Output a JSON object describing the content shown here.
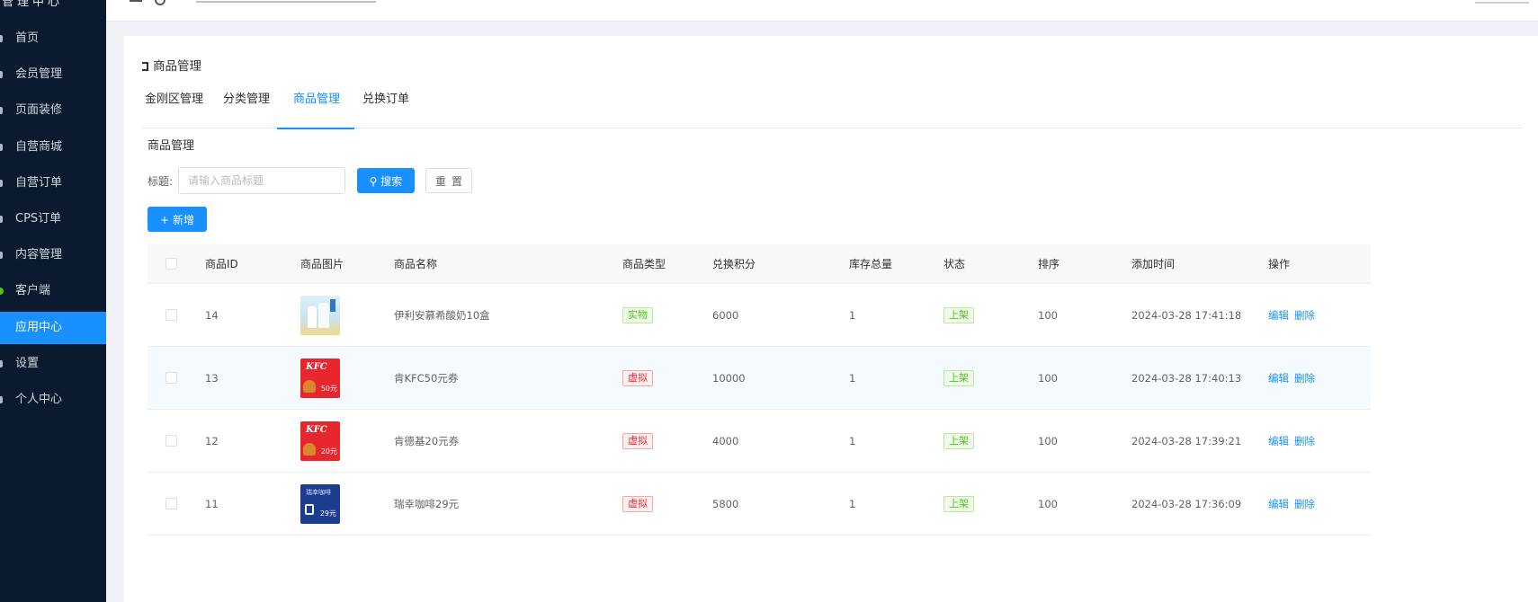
{
  "sidebar": {
    "brand": "管理中心",
    "items": [
      {
        "label": "首页"
      },
      {
        "label": "会员管理"
      },
      {
        "label": "页面装修"
      },
      {
        "label": "自营商城"
      },
      {
        "label": "自营订单"
      },
      {
        "label": "CPS订单"
      },
      {
        "label": "内容管理"
      },
      {
        "label": "客户端"
      },
      {
        "label": "应用中心",
        "active": true
      },
      {
        "label": "设置"
      },
      {
        "label": "个人中心"
      }
    ]
  },
  "page": {
    "title": "商品管理",
    "tabs": [
      {
        "label": "金刚区管理"
      },
      {
        "label": "分类管理"
      },
      {
        "label": "商品管理",
        "active": true
      },
      {
        "label": "兑换订单"
      }
    ],
    "section_title": "商品管理"
  },
  "filter": {
    "label": "标题:",
    "placeholder": "请输入商品标题",
    "search_label": "搜索",
    "reset_label": "重置",
    "add_label": "新增"
  },
  "table": {
    "headers": [
      "商品ID",
      "商品图片",
      "商品名称",
      "商品类型",
      "兑换积分",
      "库存总量",
      "状态",
      "排序",
      "添加时间",
      "操作"
    ],
    "rows": [
      {
        "id": "14",
        "image": "yili",
        "name": "伊利安慕希酸奶10盒",
        "type": "实物",
        "type_color": "green",
        "points": "6000",
        "stock": "1",
        "status": "上架",
        "sort": "100",
        "time": "2024-03-28 17:41:18",
        "edit": "编辑",
        "delete": "删除"
      },
      {
        "id": "13",
        "image": "kfc",
        "image_value": "50元",
        "name": "肯KFC50元券",
        "type": "虚拟",
        "type_color": "red",
        "points": "10000",
        "stock": "1",
        "status": "上架",
        "sort": "100",
        "time": "2024-03-28 17:40:13",
        "edit": "编辑",
        "delete": "删除"
      },
      {
        "id": "12",
        "image": "kfc",
        "image_value": "20元",
        "name": "肯德基20元券",
        "type": "虚拟",
        "type_color": "red",
        "points": "4000",
        "stock": "1",
        "status": "上架",
        "sort": "100",
        "time": "2024-03-28 17:39:21",
        "edit": "编辑",
        "delete": "删除"
      },
      {
        "id": "11",
        "image": "luckin",
        "image_top": "瑞幸咖啡",
        "image_value": "29元",
        "name": "瑞幸咖啡29元",
        "type": "虚拟",
        "type_color": "red",
        "points": "5800",
        "stock": "1",
        "status": "上架",
        "sort": "100",
        "time": "2024-03-28 17:36:09",
        "edit": "编辑",
        "delete": "删除"
      }
    ]
  },
  "colors": {
    "sidebar_bg": "#0b1a2e",
    "primary": "#1890ff",
    "tag_green": "#52c41a",
    "tag_red": "#f5222d"
  },
  "icons": {
    "menu": "menu-icon",
    "refresh": "refresh-icon",
    "search": "search-icon",
    "plus": "plus-icon"
  }
}
